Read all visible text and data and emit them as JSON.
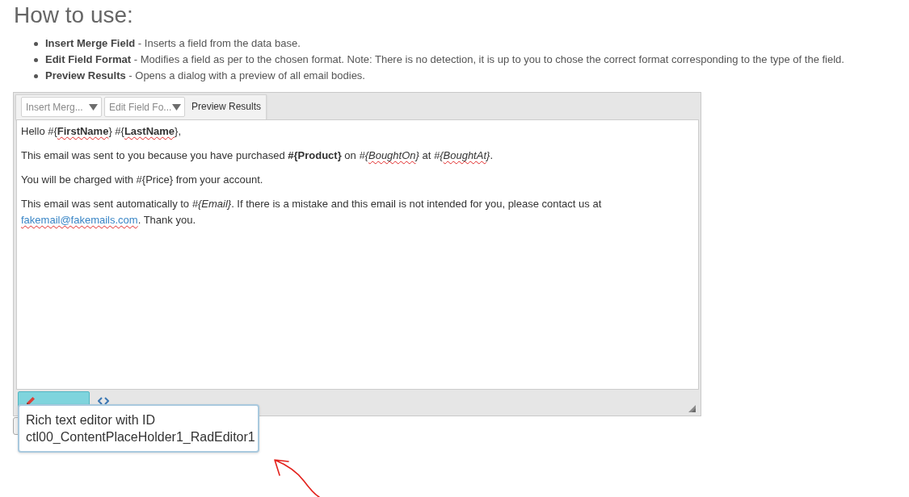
{
  "heading": "How to use:",
  "instructions": [
    {
      "text": "**Insert Merge Field** - Inserts a field from the data base."
    },
    {
      "text": "**Edit Field Format** - Modifies a field as per to the chosen format. Note: There is no detection, it is up to you to chose the correct format corresponding to the type of the field."
    },
    {
      "text": "**Preview Results** - Opens a dialog with a preview of all email bodies."
    }
  ],
  "editor": {
    "toolbar": [
      {
        "kind": "dropdown",
        "label": "Insert Merg..."
      },
      {
        "kind": "dropdown",
        "label": "Edit Field Fo..."
      },
      {
        "kind": "button",
        "label": "Preview Results"
      }
    ],
    "paragraphs": [
      {
        "segments": [
          {
            "text": "Hello #{",
            "kind": "plain",
            "misspelled": false
          },
          {
            "text": "FirstName",
            "kind": "bold",
            "misspelled": true
          },
          {
            "text": "} #{",
            "kind": "plain",
            "misspelled": false
          },
          {
            "text": "LastName",
            "kind": "bold",
            "misspelled": true
          },
          {
            "text": "},",
            "kind": "plain",
            "misspelled": false
          }
        ]
      },
      {
        "segments": [
          {
            "text": "This email was sent to you because you have purchased ",
            "kind": "plain",
            "misspelled": false
          },
          {
            "text": "#{Product}",
            "kind": "bold",
            "misspelled": false
          },
          {
            "text": " on ",
            "kind": "plain",
            "misspelled": false
          },
          {
            "text": "#{",
            "kind": "italic",
            "misspelled": false
          },
          {
            "text": "BoughtOn",
            "kind": "italic",
            "misspelled": true
          },
          {
            "text": "}",
            "kind": "italic"
          },
          {
            "text": " at ",
            "kind": "plain",
            "misspelled": false
          },
          {
            "text": "#{",
            "kind": "italic",
            "misspelled": false
          },
          {
            "text": "BoughtAt",
            "kind": "italic",
            "misspelled": true
          },
          {
            "text": "}",
            "kind": "italic"
          },
          {
            "text": ".",
            "kind": "plain"
          }
        ]
      },
      {
        "segments": [
          {
            "text": "You will be charged with #{Price} from your account.",
            "kind": "plain",
            "misspelled": false
          }
        ]
      },
      {
        "segments": [
          {
            "text": "This email was sent automatically to ",
            "kind": "plain",
            "misspelled": false
          },
          {
            "text": "#{Email}",
            "kind": "italic",
            "misspelled": false
          },
          {
            "text": ". If there is a mistake and this email is not intended for you, please contact us at ",
            "kind": "plain",
            "misspelled": false
          },
          {
            "text": "fakemail@fakemails.com",
            "kind": "link",
            "misspelled": true
          },
          {
            "text": ". Thank you.",
            "kind": "plain",
            "misspelled": false
          }
        ]
      }
    ],
    "mode_tabs": [
      {
        "kind": "design",
        "selected": true
      },
      {
        "kind": "html",
        "selected": false
      }
    ]
  },
  "tooltip": {
    "lines": [
      "Rich text editor with ID",
      "ctl00_ContentPlaceHolder1_RadEditor1"
    ]
  }
}
